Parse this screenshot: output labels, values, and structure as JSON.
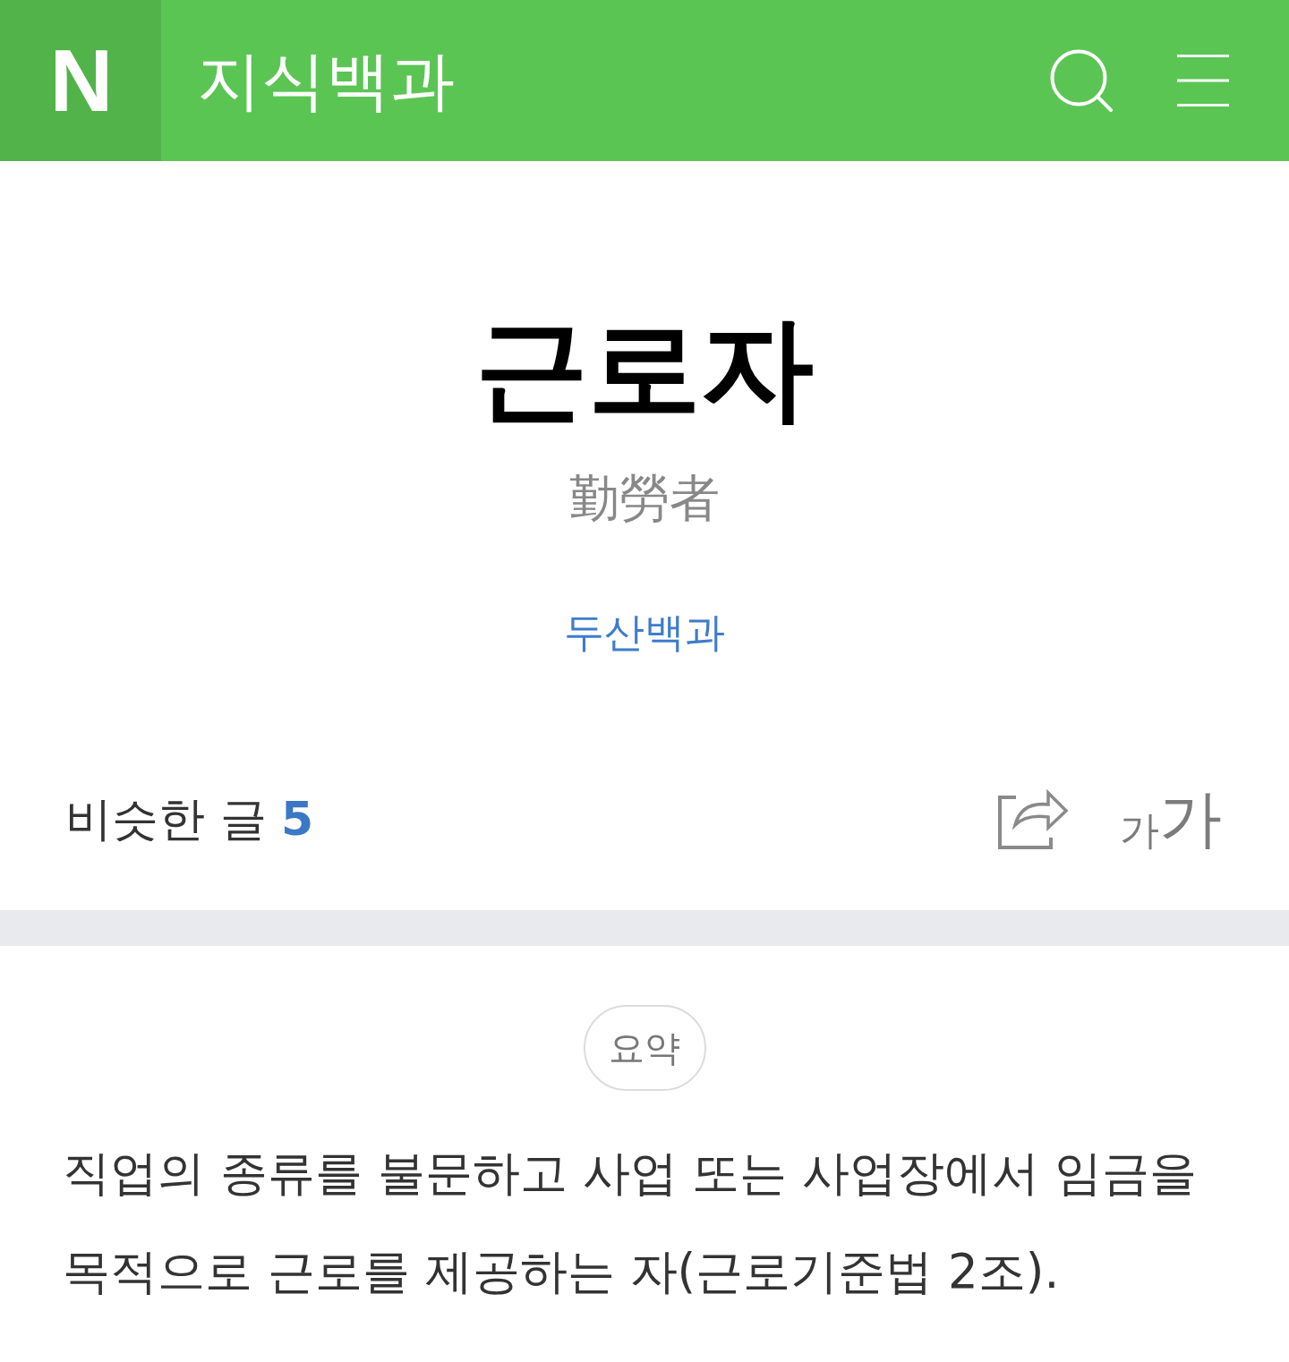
{
  "header": {
    "logo": "N",
    "title": "지식백과"
  },
  "entry": {
    "title": "근로자",
    "hanja": "勤勞者",
    "source": "두산백과"
  },
  "toolbar": {
    "similar_posts": {
      "label": "비슷한 글",
      "count": "5"
    },
    "font_size_button": {
      "small": "가",
      "large": "가"
    }
  },
  "summary": {
    "badge": "요약",
    "text": "직업의 종류를 불문하고 사업 또는 사업장에서 임금을 목적으로 근로를 제공하는 자(근로기준법 2조)."
  }
}
